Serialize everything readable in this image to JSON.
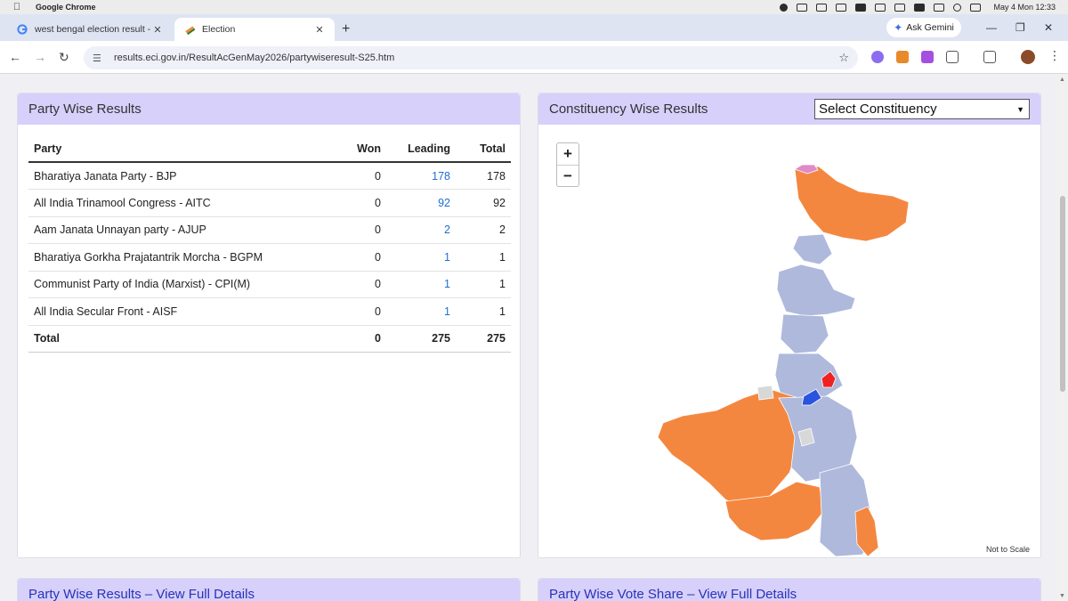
{
  "menubar": {
    "app_name": "Google Chrome",
    "clock": "May 4 Mon 12:33"
  },
  "tabs": [
    {
      "title": "west bengal election result - Go",
      "favicon": "google-g-icon",
      "active": false
    },
    {
      "title": "Election",
      "favicon": "eci-icon",
      "active": true
    }
  ],
  "gemini_label": "Ask Gemini",
  "address": {
    "url": "results.eci.gov.in/ResultAcGenMay2026/partywiseresult-S25.htm"
  },
  "party_card": {
    "title": "Party Wise Results",
    "columns": {
      "party": "Party",
      "won": "Won",
      "leading": "Leading",
      "total": "Total"
    },
    "rows": [
      {
        "party": "Bharatiya Janata Party - BJP",
        "won": "0",
        "leading": "178",
        "total": "178"
      },
      {
        "party": "All India Trinamool Congress - AITC",
        "won": "0",
        "leading": "92",
        "total": "92"
      },
      {
        "party": "Aam Janata Unnayan party - AJUP",
        "won": "0",
        "leading": "2",
        "total": "2"
      },
      {
        "party": "Bharatiya Gorkha Prajatantrik Morcha - BGPM",
        "won": "0",
        "leading": "1",
        "total": "1"
      },
      {
        "party": "Communist Party of India (Marxist) - CPI(M)",
        "won": "0",
        "leading": "1",
        "total": "1"
      },
      {
        "party": "All India Secular Front - AISF",
        "won": "0",
        "leading": "1",
        "total": "1"
      }
    ],
    "total_row": {
      "label": "Total",
      "won": "0",
      "leading": "275",
      "total": "275"
    }
  },
  "map_card": {
    "title": "Constituency Wise Results",
    "select_value": "Select Constituency",
    "zoom_in": "+",
    "zoom_out": "−",
    "note": "Not to Scale",
    "colors": {
      "bjp": "#f4873f",
      "aitc": "#aeb9dc",
      "cpim": "#ee2222",
      "aisf": "#2a54e0",
      "other": "#d8d8d8",
      "bgpm": "#e08ac8"
    }
  },
  "bottom_cards": {
    "left": "Party Wise Results – View Full Details",
    "right": "Party Wise Vote Share – View Full Details"
  }
}
